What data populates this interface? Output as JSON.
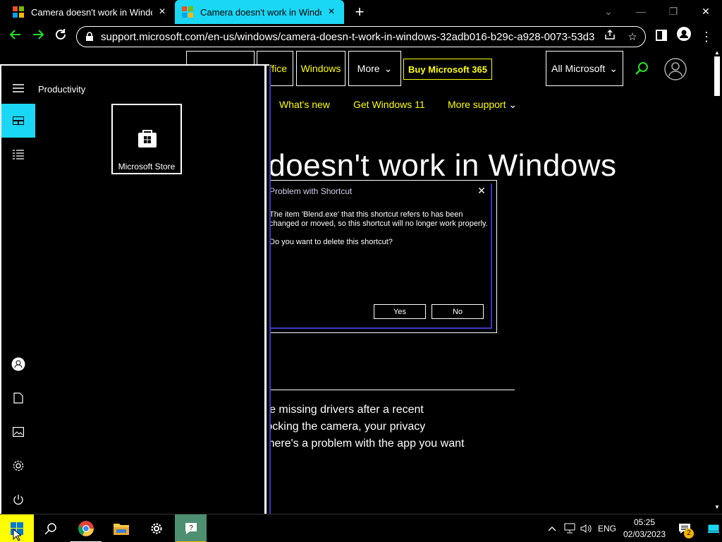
{
  "browser": {
    "tabs": [
      {
        "title": "Camera doesn't work in Windows"
      },
      {
        "title": "Camera doesn't work in Windows"
      }
    ],
    "new_tab": "+",
    "url": "support.microsoft.com/en-us/windows/camera-doesn-t-work-in-windows-32adb016-b29c-a928-0073-53d31da..."
  },
  "site_nav": {
    "items": [
      {
        "label": "Office"
      },
      {
        "label": "Windows"
      },
      {
        "label": "More"
      }
    ],
    "buy": "Buy Microsoft 365",
    "all_microsoft": "All Microsoft",
    "sub_items": [
      {
        "label": "What's new"
      },
      {
        "label": "Get Windows 11"
      },
      {
        "label": "More support"
      }
    ]
  },
  "article": {
    "headline": "Camera doesn't work in Windows",
    "body_lines": [
      "(if your camera doesn't work in Windows 10), it might be missing drivers after a recent",
      "update. It's also possible that your antivirus program is blocking the camera, your privacy",
      "settings don't allow camera access for some apps, or there's a problem with the app you want"
    ]
  },
  "dialog": {
    "title": "Problem with Shortcut",
    "line1": "The item 'Blend.exe' that this shortcut refers to has been",
    "line2": "changed or moved, so this shortcut will no longer work properly.",
    "question": "Do you want to delete this shortcut?",
    "yes": "Yes",
    "no": "No"
  },
  "start_menu": {
    "group": "Productivity",
    "tile": "Microsoft Store"
  },
  "taskbar": {
    "lang": "ENG",
    "time": "05:25",
    "date": "02/03/2023",
    "notification_count": "2"
  },
  "colors": {
    "accent_cyan": "#1ad7f5",
    "highlight_yellow": "#ffff00",
    "dialog_border": "#3a3ac4",
    "green_icon": "#23e023"
  }
}
